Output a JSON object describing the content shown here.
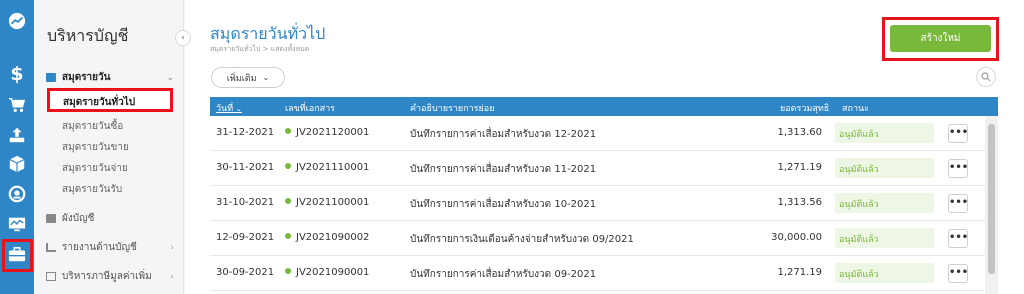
{
  "rail": {
    "icons": [
      "dashboard-icon",
      "dollar-icon",
      "cart-icon",
      "upload-icon",
      "box-icon",
      "gauge-icon",
      "monitor-chart-icon",
      "briefcase-icon"
    ],
    "accent": "#2f86c7",
    "highlight": "#e8141c"
  },
  "sidebar": {
    "title": "บริหารบัญชี",
    "group_active": "สมุดรายวัน",
    "items": [
      "สมุดรายวันทั่วไป",
      "สมุดรายวันซื้อ",
      "สมุดรายวันขาย",
      "สมุดรายวันจ่าย",
      "สมุดรายวันรับ"
    ],
    "groups": [
      "ผังบัญชี",
      "รายงานด้านบัญชี",
      "บริหารภาษีมูลค่าเพิ่ม"
    ]
  },
  "header": {
    "title": "สมุดรายวันทั่วไป",
    "breadcrumb": "สมุดรายวันทั่วไป  >  แสดงทั้งหมด",
    "create_label": "สร้างใหม่",
    "more_label": "เพิ่มเติม"
  },
  "table": {
    "headers": {
      "date": "วันที่",
      "doc_no": "เลขที่เอกสาร",
      "description": "คำอธิบายรายการย่อย",
      "total": "ยอดรวมสุทธิ",
      "status": "สถานะ"
    },
    "rows": [
      {
        "date": "31-12-2021",
        "doc_no": "JV2021120001",
        "description": "บันทึกรายการค่าเสื่อมสำหรับงวด 12-2021",
        "total": "1,313.60",
        "status": "อนุมัติแล้ว",
        "menu": "•••"
      },
      {
        "date": "30-11-2021",
        "doc_no": "JV2021110001",
        "description": "บันทึกรายการค่าเสื่อมสำหรับงวด 11-2021",
        "total": "1,271.19",
        "status": "อนุมัติแล้ว",
        "menu": "•••"
      },
      {
        "date": "31-10-2021",
        "doc_no": "JV2021100001",
        "description": "บันทึกรายการค่าเสื่อมสำหรับงวด 10-2021",
        "total": "1,313.56",
        "status": "อนุมัติแล้ว",
        "menu": "•••"
      },
      {
        "date": "12-09-2021",
        "doc_no": "JV2021090002",
        "description": "บันทึกรายการเงินเดือนค้างจ่ายสำหรับงวด 09/2021",
        "total": "30,000.00",
        "status": "อนุมัติแล้ว",
        "menu": "•••"
      },
      {
        "date": "30-09-2021",
        "doc_no": "JV2021090001",
        "description": "บันทึกรายการค่าเสื่อมสำหรับงวด 09-2021",
        "total": "1,271.19",
        "status": "อนุมัติแล้ว",
        "menu": "•••"
      }
    ],
    "status_color": "#78b83a"
  }
}
